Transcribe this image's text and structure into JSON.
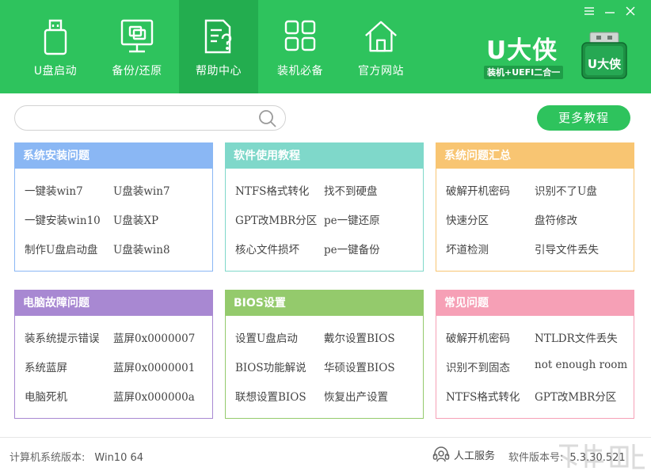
{
  "nav": {
    "items": [
      {
        "label": "U盘启动",
        "icon": "usb-drive-icon"
      },
      {
        "label": "备份/还原",
        "icon": "backup-restore-icon"
      },
      {
        "label": "帮助中心",
        "icon": "help-document-icon"
      },
      {
        "label": "装机必备",
        "icon": "apps-grid-icon"
      },
      {
        "label": "官方网站",
        "icon": "home-icon"
      }
    ],
    "active_index": 2
  },
  "brand": {
    "name": "U大侠",
    "tagline": "装机+UEFI二合一",
    "logo_text": "U大侠"
  },
  "search": {
    "placeholder": "",
    "value": ""
  },
  "more_button": "更多教程",
  "cards": [
    {
      "title": "系统安装问题",
      "color": "#8ab7f4",
      "border": "#8ab7f4",
      "links": [
        "一键装win7",
        "U盘装win7",
        "一键安装win10",
        "U盘装XP",
        "制作U盘启动盘",
        "U盘装win8"
      ]
    },
    {
      "title": "软件使用教程",
      "color": "#7fd8ca",
      "border": "#7fd8ca",
      "links": [
        "NTFS格式转化",
        "找不到硬盘",
        "GPT改MBR分区",
        "pe一键还原",
        "核心文件损坏",
        "pe一键备份"
      ]
    },
    {
      "title": "系统问题汇总",
      "color": "#f8c572",
      "border": "#f8c572",
      "links": [
        "破解开机密码",
        "识别不了U盘",
        "快速分区",
        "盘符修改",
        "坏道检测",
        "引导文件丢失"
      ]
    },
    {
      "title": "电脑故障问题",
      "color": "#a888d2",
      "border": "#a888d2",
      "links": [
        "装系统提示错误",
        "蓝屏0x0000007",
        "系统蓝屏",
        "蓝屏0x0000001",
        "电脑死机",
        "蓝屏0x000000a"
      ]
    },
    {
      "title": "BIOS设置",
      "color": "#94ca6c",
      "border": "#94ca6c",
      "links": [
        "设置U盘启动",
        "戴尔设置BIOS",
        "BIOS功能解说",
        "华硕设置BIOS",
        "联想设置BIOS",
        "恢复出产设置"
      ]
    },
    {
      "title": "常见问题",
      "color": "#f6a0b6",
      "border": "#f6a0b6",
      "links": [
        "破解开机密码",
        "NTLDR文件丢失",
        "识别不到固态",
        "not enough room",
        "NTFS格式转化",
        "GPT改MBR分区"
      ]
    }
  ],
  "footer": {
    "system_label": "计算机系统版本:",
    "system_value": "Win10 64",
    "service_label": "人工服务",
    "software_label": "软件版本号:",
    "software_value": "5.3.30.521"
  },
  "window_controls": [
    "menu-icon",
    "minimize-icon",
    "close-icon"
  ],
  "colors": {
    "header": "#2ec35d",
    "header_active": "#23ad4f",
    "accent": "#2ec35d"
  }
}
